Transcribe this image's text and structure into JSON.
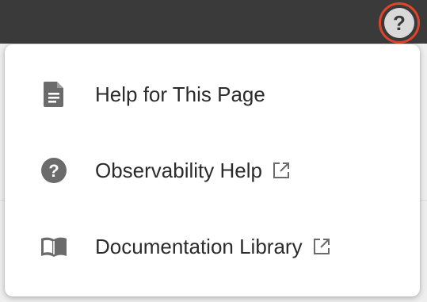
{
  "colors": {
    "topbar": "#3a3a3a",
    "highlight_ring": "#e0452b",
    "icon": "#6b6b6b",
    "text": "#2b2b2b"
  },
  "topbar": {
    "help_button_icon": "question-mark-icon",
    "help_button_glyph": "?"
  },
  "menu": {
    "items": [
      {
        "label": "Help for This Page",
        "icon": "document-icon",
        "external": false
      },
      {
        "label": "Observability Help",
        "icon": "question-circle-icon",
        "external": true
      },
      {
        "label": "Documentation Library",
        "icon": "book-icon",
        "external": true
      }
    ]
  }
}
